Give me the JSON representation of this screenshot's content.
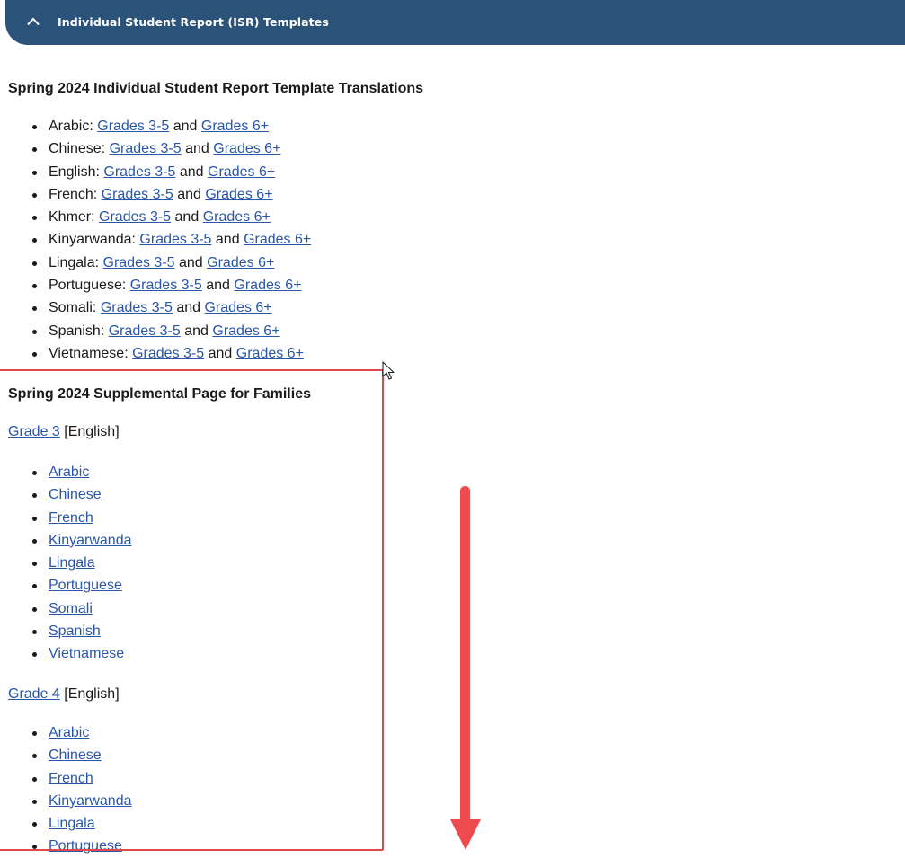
{
  "accordion": {
    "title": "Individual Student Report (ISR) Templates"
  },
  "isr_section": {
    "heading": "Spring 2024 Individual Student Report Template Translations",
    "and_word": "and",
    "items": [
      {
        "language": "Arabic:",
        "link1": "Grades 3-5",
        "link2": "Grades 6+"
      },
      {
        "language": "Chinese:",
        "link1": "Grades 3-5",
        "link2": "Grades 6+"
      },
      {
        "language": "English:",
        "link1": "Grades 3-5",
        "link2": "Grades 6+"
      },
      {
        "language": "French:",
        "link1": "Grades 3-5",
        "link2": "Grades 6+"
      },
      {
        "language": "Khmer:",
        "link1": "Grades 3-5",
        "link2": "Grades 6+"
      },
      {
        "language": "Kinyarwanda:",
        "link1": "Grades 3-5",
        "link2": "Grades 6+"
      },
      {
        "language": "Lingala:",
        "link1": "Grades 3-5",
        "link2": "Grades 6+"
      },
      {
        "language": "Portuguese:",
        "link1": "Grades 3-5",
        "link2": "Grades 6+"
      },
      {
        "language": "Somali:",
        "link1": "Grades 3-5",
        "link2": "Grades 6+"
      },
      {
        "language": "Spanish:",
        "link1": "Grades 3-5",
        "link2": "Grades 6+"
      },
      {
        "language": "Vietnamese:",
        "link1": "Grades 3-5",
        "link2": "Grades 6+"
      }
    ]
  },
  "supplemental_section": {
    "heading": "Spring 2024 Supplemental Page for Families",
    "grade3": {
      "link": "Grade 3",
      "suffix": "[English]",
      "languages": [
        "Arabic",
        "Chinese",
        "French",
        "Kinyarwanda",
        "Lingala",
        "Portuguese",
        "Somali",
        "Spanish",
        "Vietnamese"
      ]
    },
    "grade4": {
      "link": "Grade 4",
      "suffix": "[English]",
      "languages": [
        "Arabic",
        "Chinese",
        "French",
        "Kinyarwanda",
        "Lingala",
        "Portuguese"
      ]
    }
  },
  "colors": {
    "header_bg": "#2b5379",
    "link": "#2a56a8",
    "annotation_red": "#ef4b4f"
  }
}
